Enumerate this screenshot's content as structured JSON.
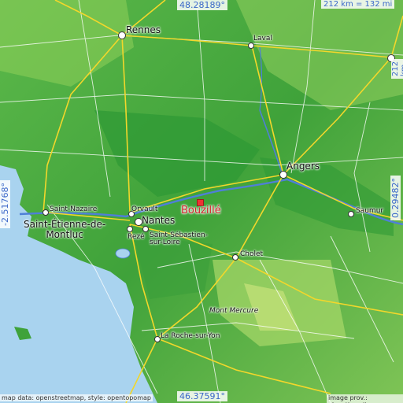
{
  "map": {
    "title": "",
    "target_place": "Bouzillé",
    "places": [
      {
        "id": "rennes",
        "name": "Rennes",
        "kind": "city"
      },
      {
        "id": "laval",
        "name": "Laval",
        "kind": "town"
      },
      {
        "id": "angers",
        "name": "Angers",
        "kind": "city"
      },
      {
        "id": "saumur",
        "name": "Saumur",
        "kind": "town"
      },
      {
        "id": "saint-nazaire",
        "name": "Saint-Nazaire",
        "kind": "town"
      },
      {
        "id": "saint-etienne",
        "name": "Saint-Étienne-de-\nMontluc",
        "kind": "town"
      },
      {
        "id": "orvault",
        "name": "Orvault",
        "kind": "town"
      },
      {
        "id": "nantes",
        "name": "Nantes",
        "kind": "city"
      },
      {
        "id": "reze",
        "name": "Rezé",
        "kind": "town"
      },
      {
        "id": "saint-sebastien",
        "name": "Saint-Sébastien-\nsur-Loire",
        "kind": "town"
      },
      {
        "id": "cholet",
        "name": "Cholet",
        "kind": "town"
      },
      {
        "id": "mont-mercure",
        "name": "Mont Mercure",
        "kind": "peak"
      },
      {
        "id": "la-roche",
        "name": "La Roche-sur-Yon",
        "kind": "town"
      }
    ],
    "coords": {
      "top_lat": "48.28189°",
      "bottom_lat": "46.37591°",
      "left_lon": "-2.51768°",
      "right_lon": "0.29482°"
    },
    "scale": {
      "horizontal": "212 km = 132 mi",
      "vertical": "212 km = 132 mi"
    },
    "attribution": {
      "left": "map data: openstreetmap, style: opentopomap",
      "right": "image prov.: elevation.city"
    },
    "colors": {
      "lowland": "#2f9a35",
      "upland": "#8fcf5a",
      "sea": "#a9d3ef",
      "river": "#4f7fd8",
      "road_major": "#f2d72b",
      "road_minor": "#ffffff",
      "coord_text": "#3b68c9",
      "target": "#d2232a"
    }
  }
}
